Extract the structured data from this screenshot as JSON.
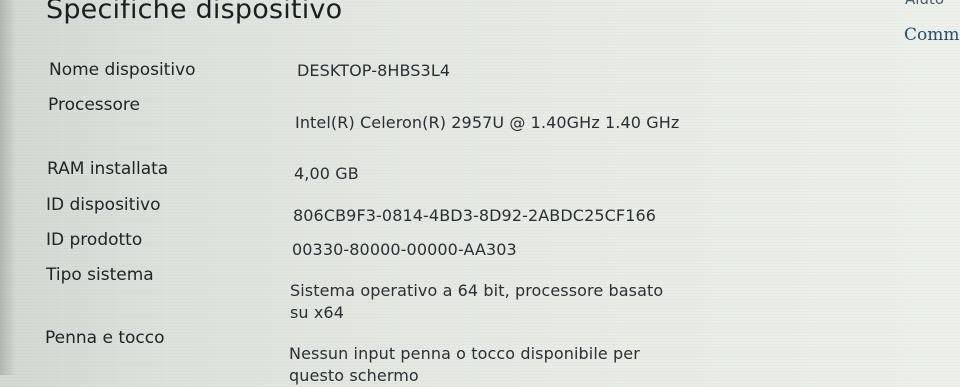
{
  "window": {
    "section_title": "Specifiche dispositivo",
    "help_link": "Aiuto",
    "comments_link": "Comm"
  },
  "specs": [
    {
      "label": "Nome dispositivo",
      "value": "DESKTOP-8HBS3L4"
    },
    {
      "label": "Processore",
      "value": "Intel(R) Celeron(R) 2957U @ 1.40GHz   1.40 GHz"
    },
    {
      "label": "RAM installata",
      "value": "4,00 GB"
    },
    {
      "label": "ID dispositivo",
      "value": "806CB9F3-0814-4BD3-8D92-2ABDC25CF166"
    },
    {
      "label": "ID prodotto",
      "value": "00330-80000-00000-AA303"
    },
    {
      "label": "Tipo sistema",
      "value": "Sistema operativo a 64 bit, processore basato su x64"
    },
    {
      "label": "Penna e tocco",
      "value": "Nessun input penna o tocco disponibile per questo schermo"
    }
  ]
}
